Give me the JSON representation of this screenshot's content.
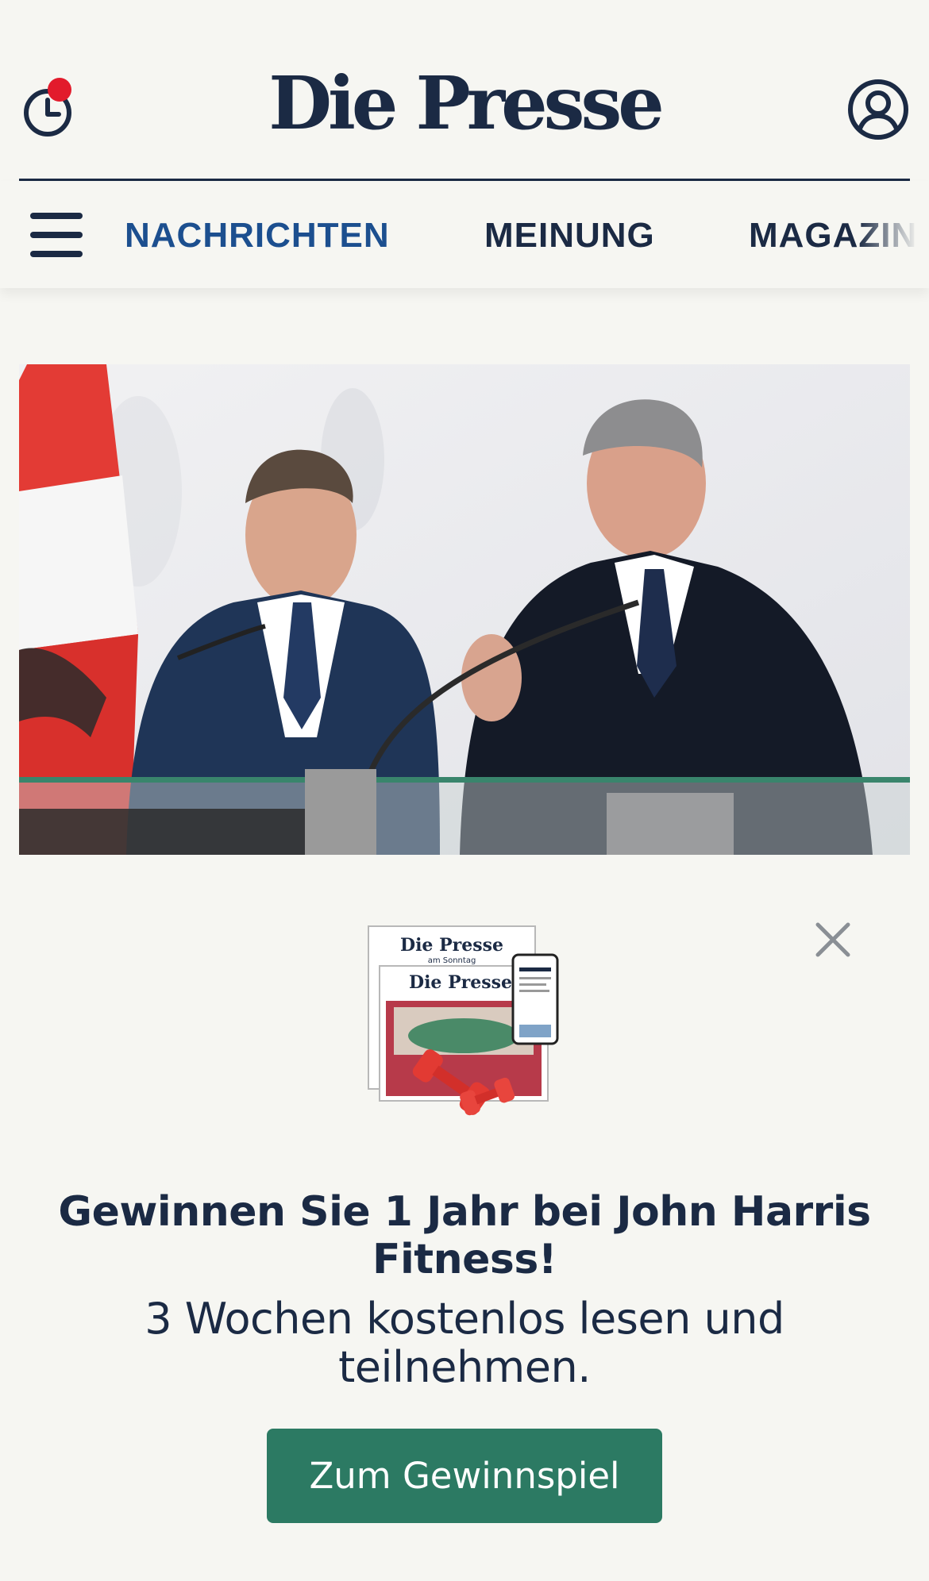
{
  "header": {
    "logo_text": "Die Presse",
    "history_icon": "clock-icon",
    "notification_icon": "notification-dot-icon",
    "profile_icon": "user-circle-icon"
  },
  "nav": {
    "menu_icon": "hamburger-menu-icon",
    "items": [
      {
        "label": "NACHRICHTEN",
        "active": true
      },
      {
        "label": "MEINUNG",
        "active": false
      },
      {
        "label": "MAGAZIN",
        "active": false
      }
    ]
  },
  "promo": {
    "art_logo_sunday": "Die Presse",
    "art_logo_sunday_sub": "am Sonntag",
    "art_logo_daily": "Die Presse",
    "title": "Gewinnen Sie 1 Jahr bei John Harris Fitness!",
    "subtitle": "3 Wochen kostenlos lesen und teilnehmen.",
    "cta_label": "Zum Gewinnspiel",
    "close_icon": "close-icon"
  },
  "colors": {
    "background": "#f6f6f2",
    "brand_navy": "#1b2a44",
    "nav_active": "#1c4f8f",
    "cta_green": "#2c7a63",
    "notification_red": "#e21b2c"
  }
}
